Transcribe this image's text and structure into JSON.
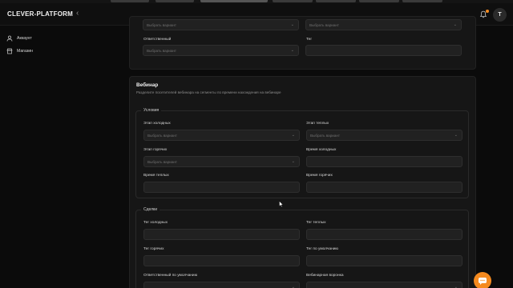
{
  "app": {
    "brand": "CLEVER-PLATFORM",
    "avatar_initial": "T"
  },
  "icons": {
    "collapse": "chevron-left-icon",
    "notifications": "bell-icon",
    "account": "user-icon",
    "store": "shop-icon",
    "chat": "chat-icon"
  },
  "colors": {
    "accent": "#f58a1f",
    "background": "#0b0b0b",
    "card": "#161616",
    "field": "#212121"
  },
  "sidebar": {
    "items": [
      {
        "label": "Аккаунт"
      },
      {
        "label": "Магазин"
      }
    ]
  },
  "top_card": {
    "fields": [
      {
        "label": "",
        "placeholder": "Выбрать вариант",
        "select": true
      },
      {
        "label": "",
        "placeholder": "Выбрать вариант",
        "select": true
      },
      {
        "label": "Ответственный",
        "placeholder": "Выбрать вариант",
        "select": true
      },
      {
        "label": "Тег",
        "placeholder": "",
        "select": false
      }
    ]
  },
  "webinar": {
    "title": "Вебинар",
    "subtitle": "Разделите посетителей вебинара на сегменты по времени нахождения на вебинаре",
    "conditions": {
      "legend": "Условия",
      "fields": [
        {
          "label": "Этап холодных",
          "placeholder": "Выбрать вариант",
          "select": true
        },
        {
          "label": "Этап теплых",
          "placeholder": "Выбрать вариант",
          "select": true
        },
        {
          "label": "Этап горячих",
          "placeholder": "Выбрать вариант",
          "select": true
        },
        {
          "label": "Время холодных",
          "placeholder": "",
          "select": false
        },
        {
          "label": "Время теплых",
          "placeholder": "",
          "select": false
        },
        {
          "label": "Время горячих",
          "placeholder": "",
          "select": false
        }
      ]
    },
    "deals": {
      "legend": "Сделки",
      "fields": [
        {
          "label": "Тег холодных",
          "placeholder": "",
          "select": false
        },
        {
          "label": "Тег теплых",
          "placeholder": "",
          "select": false
        },
        {
          "label": "Тег горячих",
          "placeholder": "",
          "select": false
        },
        {
          "label": "Тег по умолчанию",
          "placeholder": "",
          "select": false
        },
        {
          "label": "Ответственный по умолчанию",
          "placeholder": "",
          "select": true
        },
        {
          "label": "Вебинарная воронка",
          "placeholder": "",
          "select": true
        }
      ]
    }
  }
}
